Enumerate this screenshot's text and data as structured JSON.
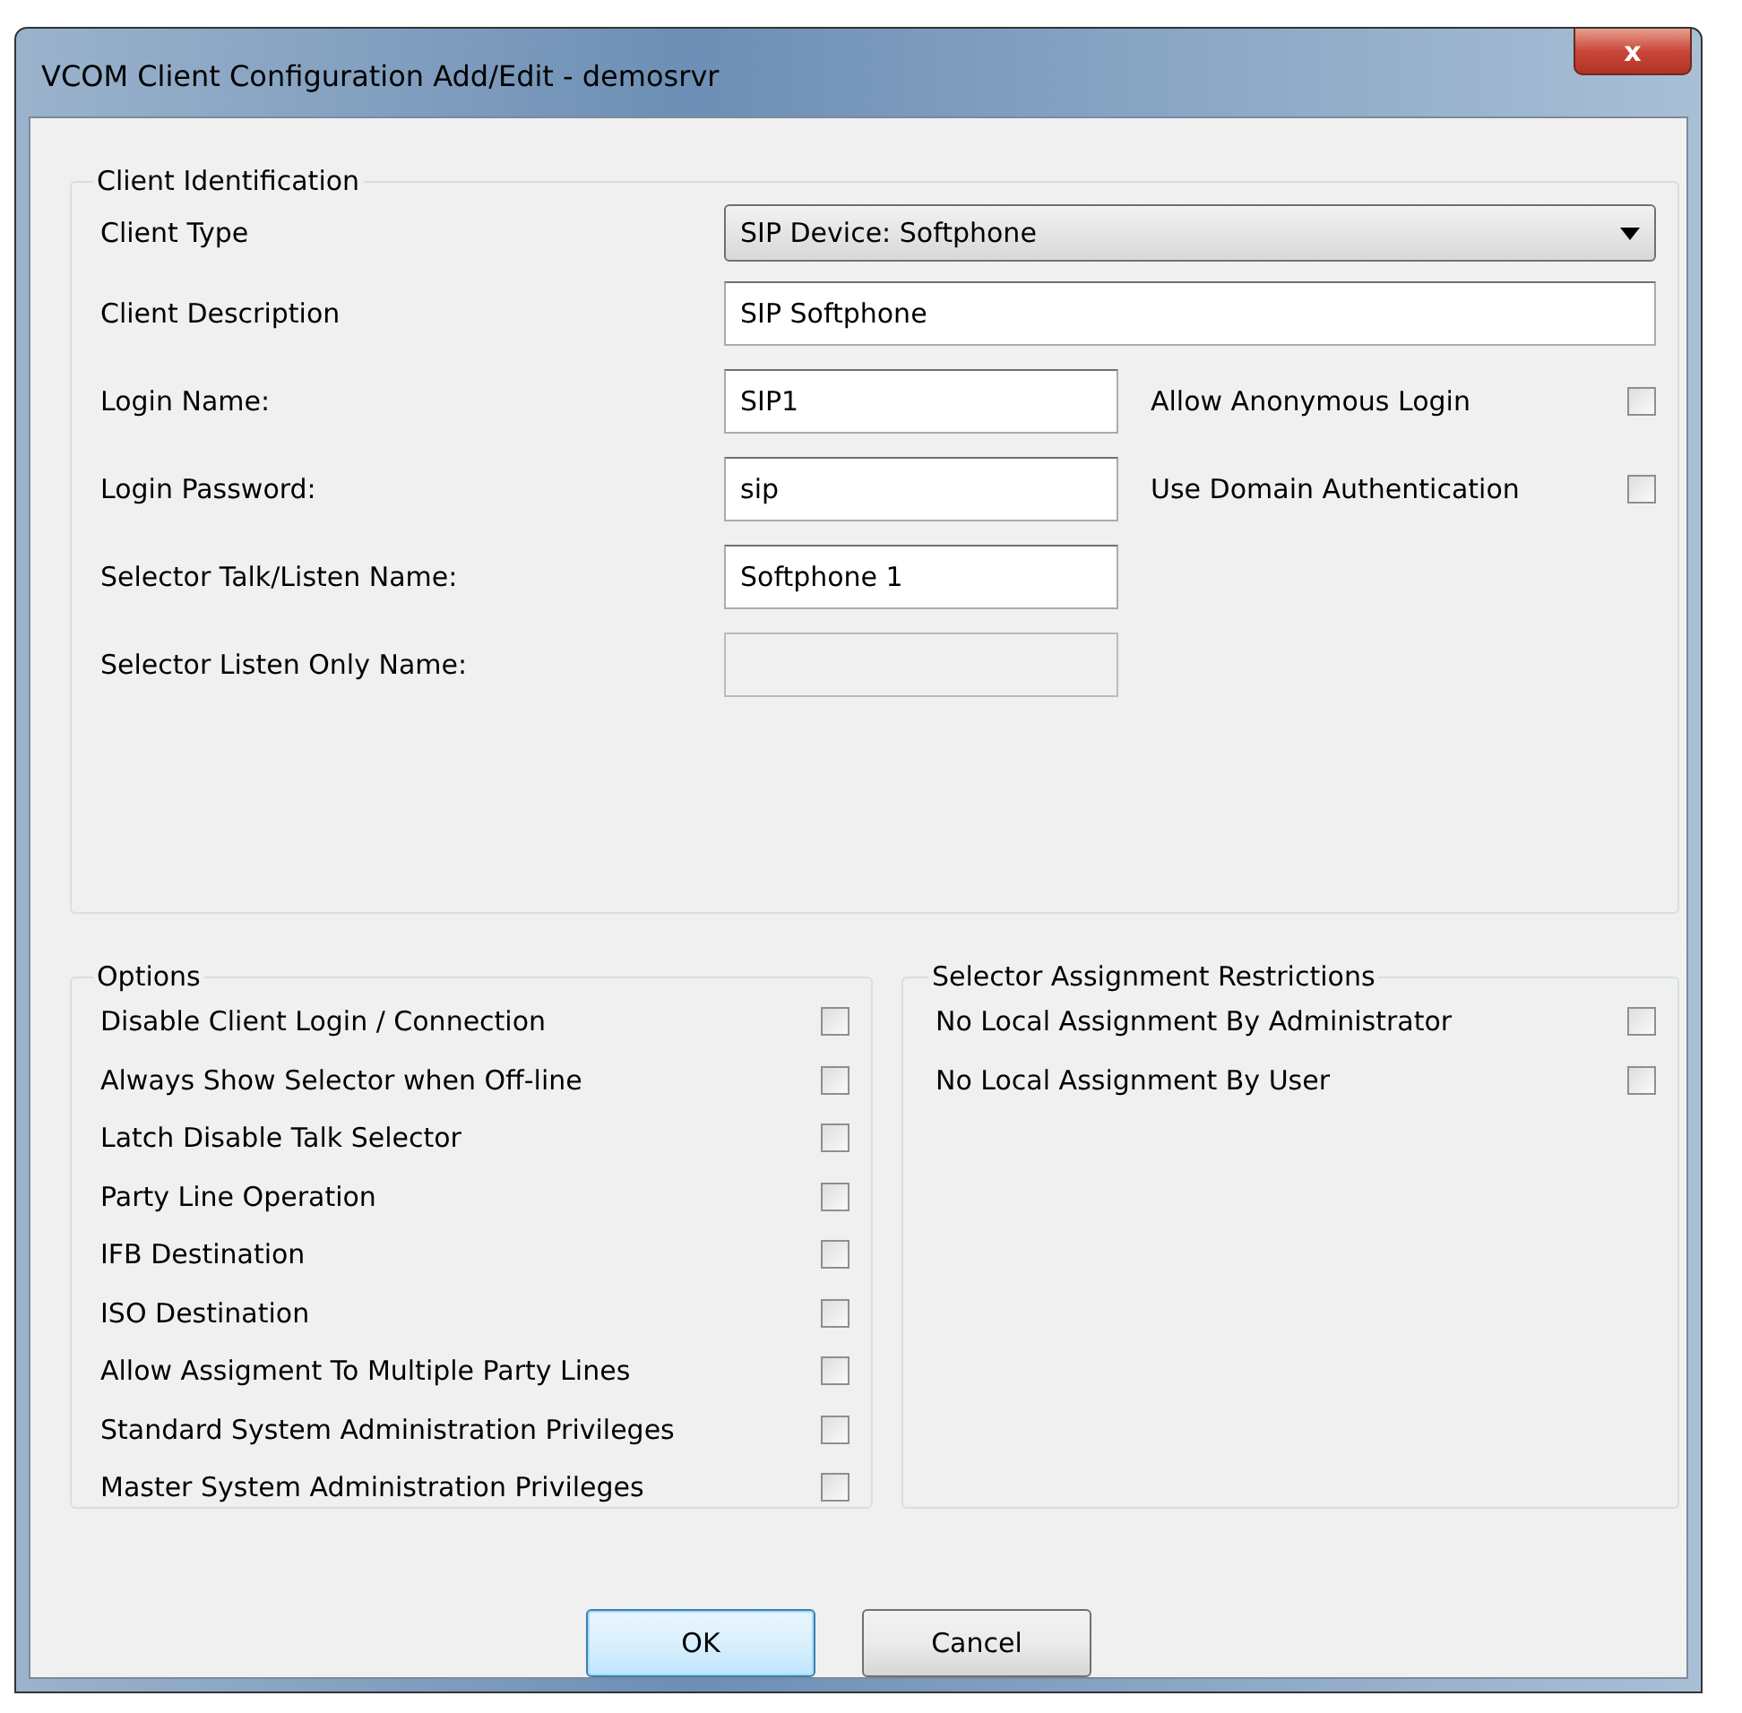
{
  "window": {
    "title": "VCOM Client Configuration Add/Edit - demosrvr",
    "close": "x"
  },
  "client_identification": {
    "title": "Client Identification",
    "rows": [
      {
        "label": "Client Type",
        "kind": "select",
        "value": "SIP Device: Softphone"
      },
      {
        "label": "Client Description",
        "kind": "wide_input",
        "value": "SIP Softphone"
      },
      {
        "label": "Login Name:",
        "kind": "input",
        "value": "SIP1",
        "option": {
          "label": "Allow Anonymous Login",
          "checked": false
        }
      },
      {
        "label": "Login Password:",
        "kind": "input",
        "value": "sip",
        "option": {
          "label": "Use Domain Authentication",
          "checked": false
        }
      },
      {
        "label": "Selector Talk/Listen Name:",
        "kind": "input",
        "value": "Softphone 1"
      },
      {
        "label": "Selector Listen Only Name:",
        "kind": "input",
        "disabled": true
      }
    ]
  },
  "options": {
    "title": "Options",
    "items": [
      {
        "label": "Disable Client Login / Connection",
        "checked": false
      },
      {
        "label": "Always Show Selector when Off-line",
        "checked": false
      },
      {
        "label": "Latch Disable Talk Selector",
        "checked": false
      },
      {
        "label": "Party Line Operation",
        "checked": false
      },
      {
        "label": "IFB Destination",
        "checked": false
      },
      {
        "label": "ISO Destination",
        "checked": false
      },
      {
        "label": "Allow Assigment To Multiple Party Lines",
        "checked": false
      },
      {
        "label": "Standard System Administration Privileges",
        "checked": false
      },
      {
        "label": "Master System Administration Privileges",
        "checked": false
      }
    ]
  },
  "selector_assignment_restrictions": {
    "title": "Selector Assignment Restrictions",
    "items": [
      {
        "label": "No Local Assignment By Administrator",
        "checked": false
      },
      {
        "label": "No Local Assignment By User",
        "checked": false
      }
    ]
  },
  "buttons": [
    {
      "label": "OK",
      "default": true
    },
    {
      "label": "Cancel",
      "default": false
    }
  ]
}
